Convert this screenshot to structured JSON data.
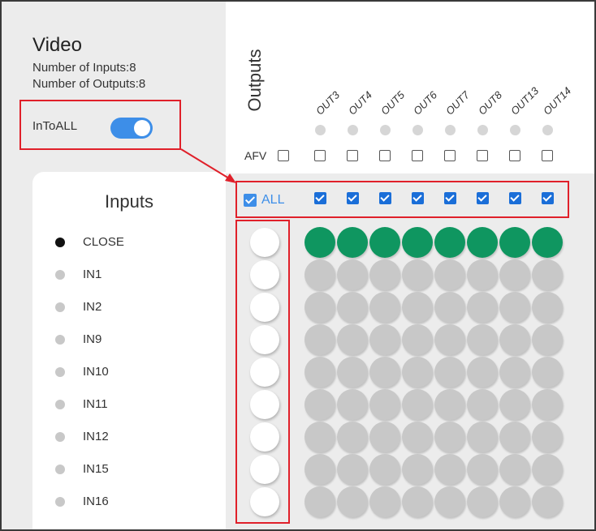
{
  "header": {
    "title": "Video",
    "inputs_count": "Number of Inputs:8",
    "outputs_count": "Number of Outputs:8",
    "intoall_label": "InToALL",
    "intoall_on": true
  },
  "inputs": {
    "title": "Inputs",
    "items": [
      {
        "label": "CLOSE",
        "active": true
      },
      {
        "label": "IN1",
        "active": false
      },
      {
        "label": "IN2",
        "active": false
      },
      {
        "label": "IN9",
        "active": false
      },
      {
        "label": "IN10",
        "active": false
      },
      {
        "label": "IN11",
        "active": false
      },
      {
        "label": "IN12",
        "active": false
      },
      {
        "label": "IN15",
        "active": false
      },
      {
        "label": "IN16",
        "active": false
      }
    ]
  },
  "outputs": {
    "title": "Outputs",
    "labels": [
      "OUT3",
      "OUT4",
      "OUT5",
      "OUT6",
      "OUT7",
      "OUT8",
      "OUT13",
      "OUT14"
    ],
    "afv_label": "AFV",
    "afv_checked": false,
    "all_label": "ALL",
    "all_checked": true
  },
  "matrix": {
    "routed_input": "CLOSE",
    "active_color": "#0f9660",
    "inactive_color": "#c8c8c8"
  },
  "colors": {
    "accent": "#3d8ee8",
    "highlight": "#e0202a"
  }
}
